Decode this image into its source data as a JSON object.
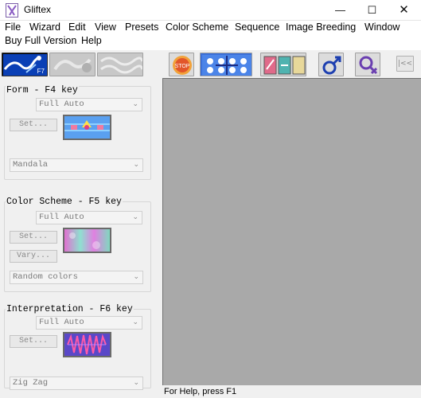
{
  "window": {
    "title": "Gliftex",
    "minimize_glyph": "—",
    "maximize_glyph": "☐",
    "close_glyph": "✕"
  },
  "menu": [
    "File",
    "Wizard",
    "Edit",
    "View",
    "Presets",
    "Color Scheme",
    "Sequence",
    "Image Breeding",
    "Window",
    "Buy Full Version",
    "Help"
  ],
  "toolbar": {
    "form_key_hint": "F7",
    "stop_label": "STOP",
    "collapse_glyph": "|<<",
    "icons": [
      "form-tool-icon",
      "glyph-tool-icon",
      "interpretation-tool-icon",
      "stop-icon",
      "pattern-grid-icon",
      "image-breeding-icon",
      "male-symbol-icon",
      "female-symbol-icon",
      "collapse-panel-icon"
    ]
  },
  "panels": {
    "form": {
      "title": "Form - F4 key",
      "mode": "Full Auto",
      "set_label": "Set...",
      "preset": "Mandala"
    },
    "color_scheme": {
      "title": "Color Scheme - F5 key",
      "mode": "Full Auto",
      "set_label": "Set...",
      "vary_label": "Vary...",
      "preset": "Random colors"
    },
    "interpretation": {
      "title": "Interpretation - F6 key",
      "mode": "Full Auto",
      "set_label": "Set...",
      "preset": "Zig Zag"
    }
  },
  "combo_arrow": "⌄",
  "status": "For Help, press F1"
}
